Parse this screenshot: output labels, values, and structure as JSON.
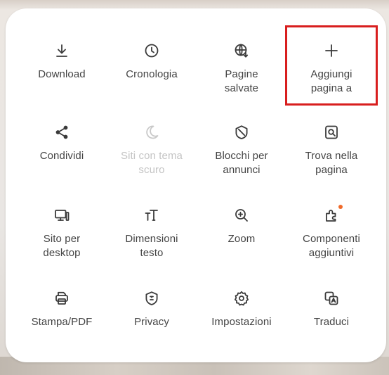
{
  "menu": {
    "items": [
      {
        "label": "Download"
      },
      {
        "label": "Cronologia"
      },
      {
        "label": "Pagine\nsalvate"
      },
      {
        "label": "Aggiungi\npagina a"
      },
      {
        "label": "Condividi"
      },
      {
        "label": "Siti con tema\nscuro"
      },
      {
        "label": "Blocchi per\nannunci"
      },
      {
        "label": "Trova nella\npagina"
      },
      {
        "label": "Sito per\ndesktop"
      },
      {
        "label": "Dimensioni\ntesto"
      },
      {
        "label": "Zoom"
      },
      {
        "label": "Componenti\naggiuntivi"
      },
      {
        "label": "Stampa/PDF"
      },
      {
        "label": "Privacy"
      },
      {
        "label": "Impostazioni"
      },
      {
        "label": "Traduci"
      }
    ]
  },
  "colors": {
    "highlight": "#d81e1e",
    "notification_dot": "#f06a2a",
    "icon": "#3a3a3a",
    "disabled": "#c4c4c4"
  }
}
